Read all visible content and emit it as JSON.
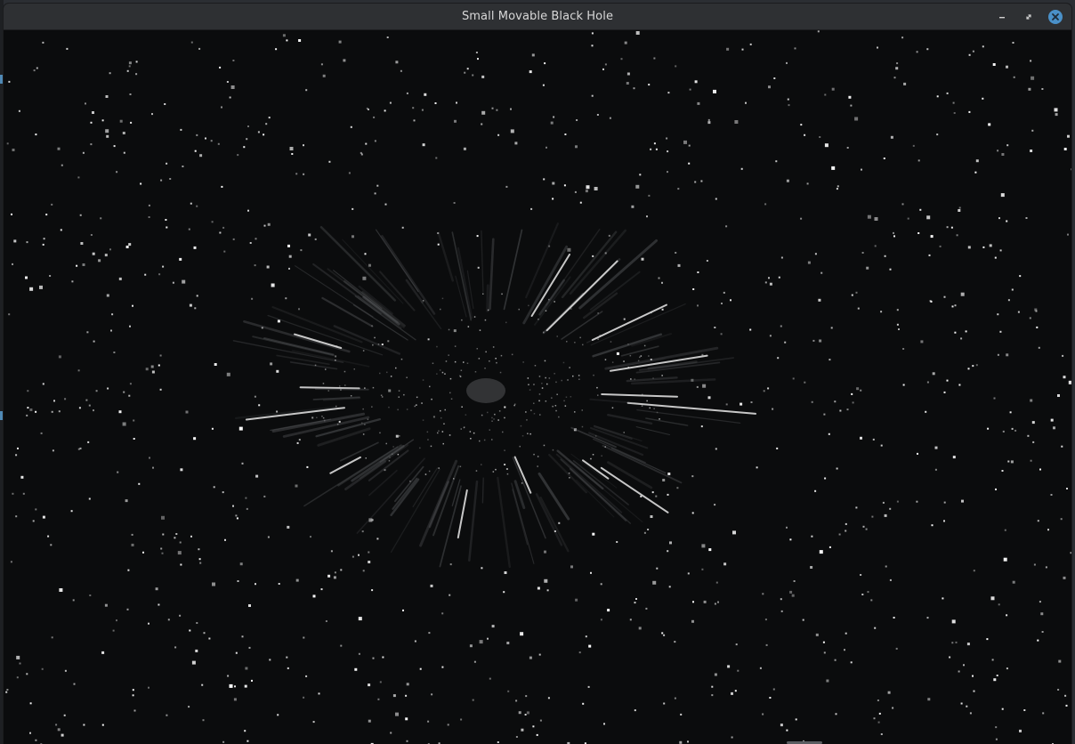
{
  "window": {
    "title": "Small Movable Black Hole",
    "controls": [
      {
        "name": "minimize-button",
        "icon": "minimize-icon"
      },
      {
        "name": "maximize-button",
        "icon": "maximize-icon"
      },
      {
        "name": "close-button",
        "icon": "close-icon"
      }
    ]
  },
  "scene": {
    "background_color": "#0b0c0d",
    "star_color": "#ffffff",
    "black_hole_shadow_color": "#3a3b3d",
    "close_button_color": "#4a90c8"
  }
}
